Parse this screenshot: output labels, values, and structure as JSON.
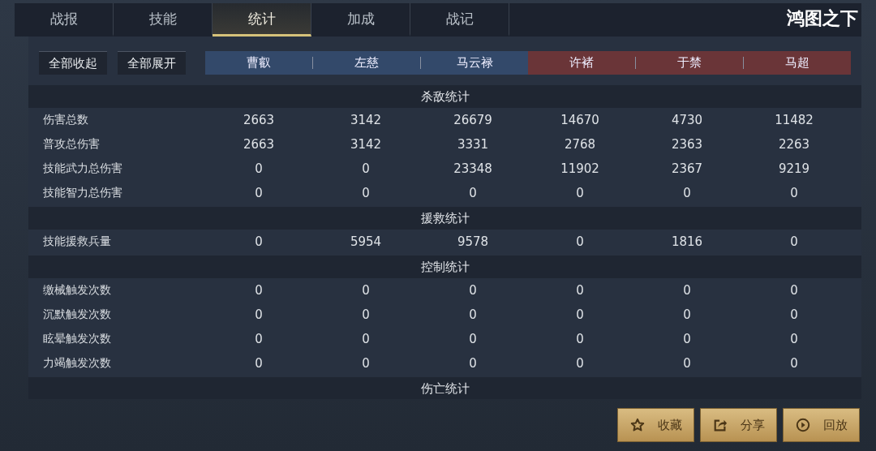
{
  "tabs": [
    {
      "label": "战报",
      "selected": false
    },
    {
      "label": "技能",
      "selected": false
    },
    {
      "label": "统计",
      "selected": true
    },
    {
      "label": "加成",
      "selected": false
    },
    {
      "label": "战记",
      "selected": false
    }
  ],
  "logo": "鸿图之下",
  "actions": [
    "全部收起",
    "全部展开"
  ],
  "teams": [
    {
      "kind": "blue",
      "heroes": [
        "曹叡",
        "左慈",
        "马云禄"
      ]
    },
    {
      "kind": "red",
      "heroes": [
        "许褚",
        "于禁",
        "马超"
      ]
    }
  ],
  "sections": [
    {
      "title": "杀敌统计",
      "rows": [
        {
          "label": "伤害总数",
          "values": [
            "2663",
            "3142",
            "26679",
            "14670",
            "4730",
            "11482"
          ]
        },
        {
          "label": "普攻总伤害",
          "values": [
            "2663",
            "3142",
            "3331",
            "2768",
            "2363",
            "2263"
          ]
        },
        {
          "label": "技能武力总伤害",
          "values": [
            "0",
            "0",
            "23348",
            "11902",
            "2367",
            "9219"
          ]
        },
        {
          "label": "技能智力总伤害",
          "values": [
            "0",
            "0",
            "0",
            "0",
            "0",
            "0"
          ]
        }
      ]
    },
    {
      "title": "援救统计",
      "rows": [
        {
          "label": "技能援救兵量",
          "values": [
            "0",
            "5954",
            "9578",
            "0",
            "1816",
            "0"
          ]
        }
      ]
    },
    {
      "title": "控制统计",
      "rows": [
        {
          "label": "缴械触发次数",
          "values": [
            "0",
            "0",
            "0",
            "0",
            "0",
            "0"
          ]
        },
        {
          "label": "沉默触发次数",
          "values": [
            "0",
            "0",
            "0",
            "0",
            "0",
            "0"
          ]
        },
        {
          "label": "眩晕触发次数",
          "values": [
            "0",
            "0",
            "0",
            "0",
            "0",
            "0"
          ]
        },
        {
          "label": "力竭触发次数",
          "values": [
            "0",
            "0",
            "0",
            "0",
            "0",
            "0"
          ]
        }
      ]
    },
    {
      "title": "伤亡统计"
    }
  ],
  "buttons": [
    {
      "kind": "star",
      "label": "收藏"
    },
    {
      "kind": "share",
      "label": "分享"
    },
    {
      "kind": "replay",
      "label": "回放"
    }
  ]
}
